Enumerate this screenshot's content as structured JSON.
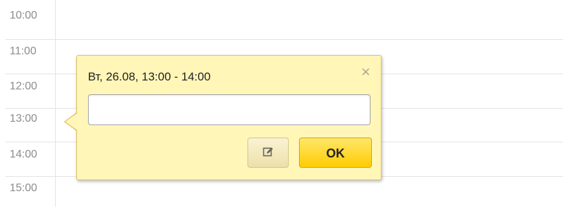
{
  "calendar": {
    "hours": [
      "10:00",
      "11:00",
      "12:00",
      "13:00",
      "14:00",
      "15:00"
    ]
  },
  "popup": {
    "title": "Вт, 26.08, 13:00 - 14:00",
    "close_icon": "close-icon",
    "input_value": "",
    "input_placeholder": "",
    "edit_icon": "pencil-edit-icon",
    "ok_label": "OK"
  },
  "colors": {
    "popup_background": "#fff6b8",
    "popup_border": "#e0c25a",
    "ok_button": "#ffcc00",
    "grid_line": "#e3e3e3",
    "hour_text": "#8c8c8c"
  }
}
